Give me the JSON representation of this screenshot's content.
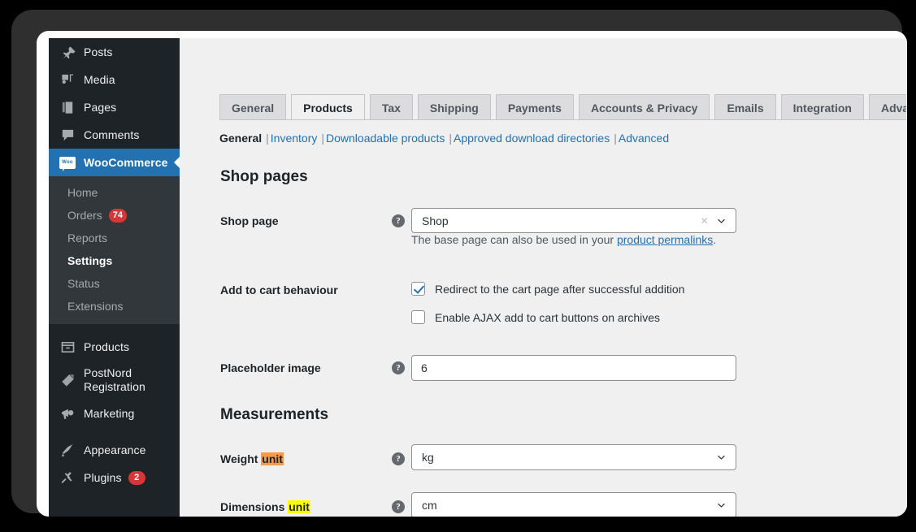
{
  "sidebar": {
    "top_items": [
      {
        "label": "Posts",
        "icon": "pin-icon",
        "active": false
      },
      {
        "label": "Media",
        "icon": "media-icon",
        "active": false
      },
      {
        "label": "Pages",
        "icon": "pages-icon",
        "active": false
      },
      {
        "label": "Comments",
        "icon": "comments-icon",
        "active": false
      }
    ],
    "woocommerce": {
      "label": "WooCommerce",
      "icon": "woocommerce-icon",
      "badge_text": "Woo"
    },
    "submenu": [
      {
        "label": "Home",
        "current": false,
        "count": ""
      },
      {
        "label": "Orders",
        "current": false,
        "count": "74"
      },
      {
        "label": "Reports",
        "current": false,
        "count": ""
      },
      {
        "label": "Settings",
        "current": true,
        "count": ""
      },
      {
        "label": "Status",
        "current": false,
        "count": ""
      },
      {
        "label": "Extensions",
        "current": false,
        "count": ""
      }
    ],
    "bottom_items": [
      {
        "label": "Products",
        "icon": "products-icon",
        "count": ""
      },
      {
        "label": "PostNord Registration",
        "icon": "postnord-icon",
        "count": ""
      },
      {
        "label": "Marketing",
        "icon": "megaphone-icon",
        "count": ""
      },
      {
        "label": "Appearance",
        "icon": "appearance-brush-icon",
        "count": ""
      },
      {
        "label": "Plugins",
        "icon": "plugin-icon",
        "count": "2"
      }
    ]
  },
  "tabs": [
    {
      "label": "General",
      "active": false
    },
    {
      "label": "Products",
      "active": true
    },
    {
      "label": "Tax",
      "active": false
    },
    {
      "label": "Shipping",
      "active": false
    },
    {
      "label": "Payments",
      "active": false
    },
    {
      "label": "Accounts & Privacy",
      "active": false
    },
    {
      "label": "Emails",
      "active": false
    },
    {
      "label": "Integration",
      "active": false
    },
    {
      "label": "Advanced",
      "active": false
    }
  ],
  "subnav": {
    "current": "General",
    "links": [
      "Inventory",
      "Downloadable products",
      "Approved download directories",
      "Advanced"
    ],
    "separator": "|"
  },
  "sections": {
    "shop_pages": {
      "heading": "Shop pages",
      "shop_page": {
        "label": "Shop page",
        "help": "?",
        "value": "Shop",
        "clear_glyph": "×",
        "description_before": "The base page can also be used in your ",
        "description_link": "product permalinks",
        "description_after": "."
      },
      "add_to_cart": {
        "label": "Add to cart behaviour",
        "options": [
          {
            "text": "Redirect to the cart page after successful addition",
            "checked": true
          },
          {
            "text": "Enable AJAX add to cart buttons on archives",
            "checked": false
          }
        ]
      },
      "placeholder_image": {
        "label": "Placeholder image",
        "help": "?",
        "value": "6"
      }
    },
    "measurements": {
      "heading": "Measurements",
      "weight_unit": {
        "label_prefix": "Weight ",
        "label_highlight": "unit",
        "highlight_color": "#f79a4b",
        "help": "?",
        "value": "kg"
      },
      "dimensions_unit": {
        "label_prefix": "Dimensions ",
        "label_highlight": "unit",
        "highlight_color": "#ffff00",
        "help": "?",
        "value": "cm"
      }
    }
  },
  "theme": {
    "sidebar_bg": "#1d2327",
    "submenu_bg": "#32373c",
    "accent_blue": "#2271b1",
    "badge_red": "#d63638",
    "content_bg": "#f0f0f1"
  }
}
